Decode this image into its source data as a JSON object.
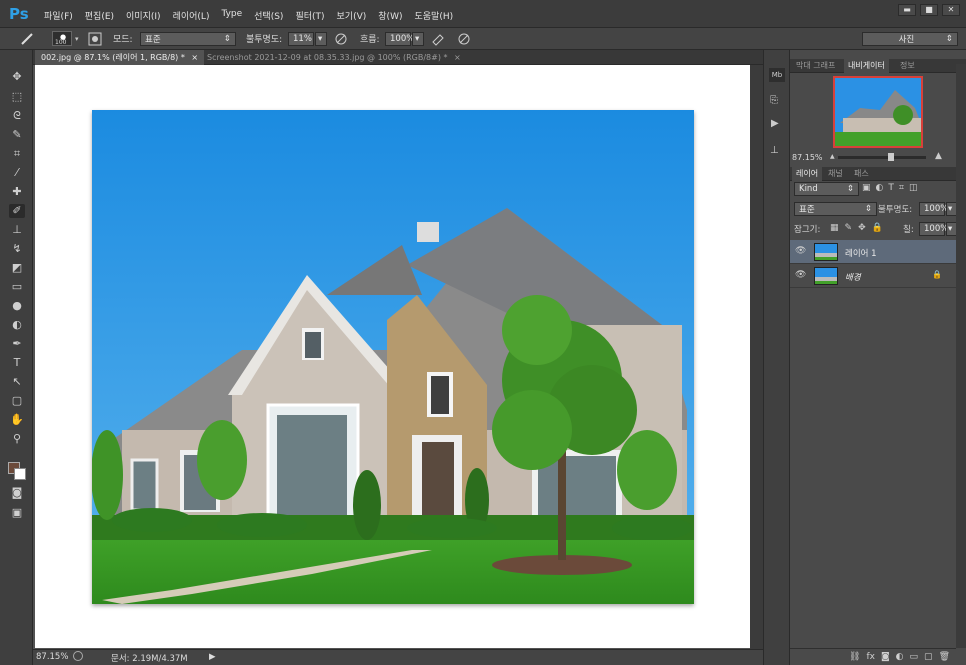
{
  "app": {
    "logo": "Ps"
  },
  "menu": [
    "파일(F)",
    "편집(E)",
    "이미지(I)",
    "레이어(L)",
    "Type",
    "선택(S)",
    "필터(T)",
    "보기(V)",
    "창(W)",
    "도움말(H)"
  ],
  "window_controls": {
    "minimize": "▬",
    "restore": "■",
    "close": "✕"
  },
  "options": {
    "brush_size": "100",
    "mode_label": "모드:",
    "mode_value": "표준",
    "opacity_label": "불투명도:",
    "opacity_value": "11%",
    "flow_label": "흐름:",
    "flow_value": "100%",
    "workspace": "사진"
  },
  "tabs": [
    {
      "label": "002.jpg @ 87.1% (레이어 1, RGB/8) *",
      "close": "×"
    },
    {
      "label": "Screenshot 2021-12-09 at 08.35.33.jpg @ 100% (RGB/8#) *",
      "close": "×"
    }
  ],
  "status": {
    "zoom": "87.15%",
    "doc": "문서: 2.19M/4.37M",
    "arrow": "▶"
  },
  "navigator": {
    "tabs": [
      "막대 그래프",
      "내비게이터",
      "정보"
    ],
    "zoom": "87.15%"
  },
  "layers_panel": {
    "tabs": [
      "레이어",
      "채널",
      "패스"
    ],
    "filter": "Kind",
    "blend": "표준",
    "opacity_label": "불투명도:",
    "opacity_value": "100%",
    "lock_label": "잠그기:",
    "fill_label": "칠:",
    "fill_value": "100%",
    "layers": [
      {
        "name": "레이어 1",
        "selected": true
      },
      {
        "name": "배경",
        "selected": false,
        "locked": true
      }
    ]
  },
  "colors": {
    "accent": "#2fa0e6",
    "foreground": "#6b4a3a",
    "background": "#ffffff",
    "selected_layer": "#5e6a7a"
  }
}
